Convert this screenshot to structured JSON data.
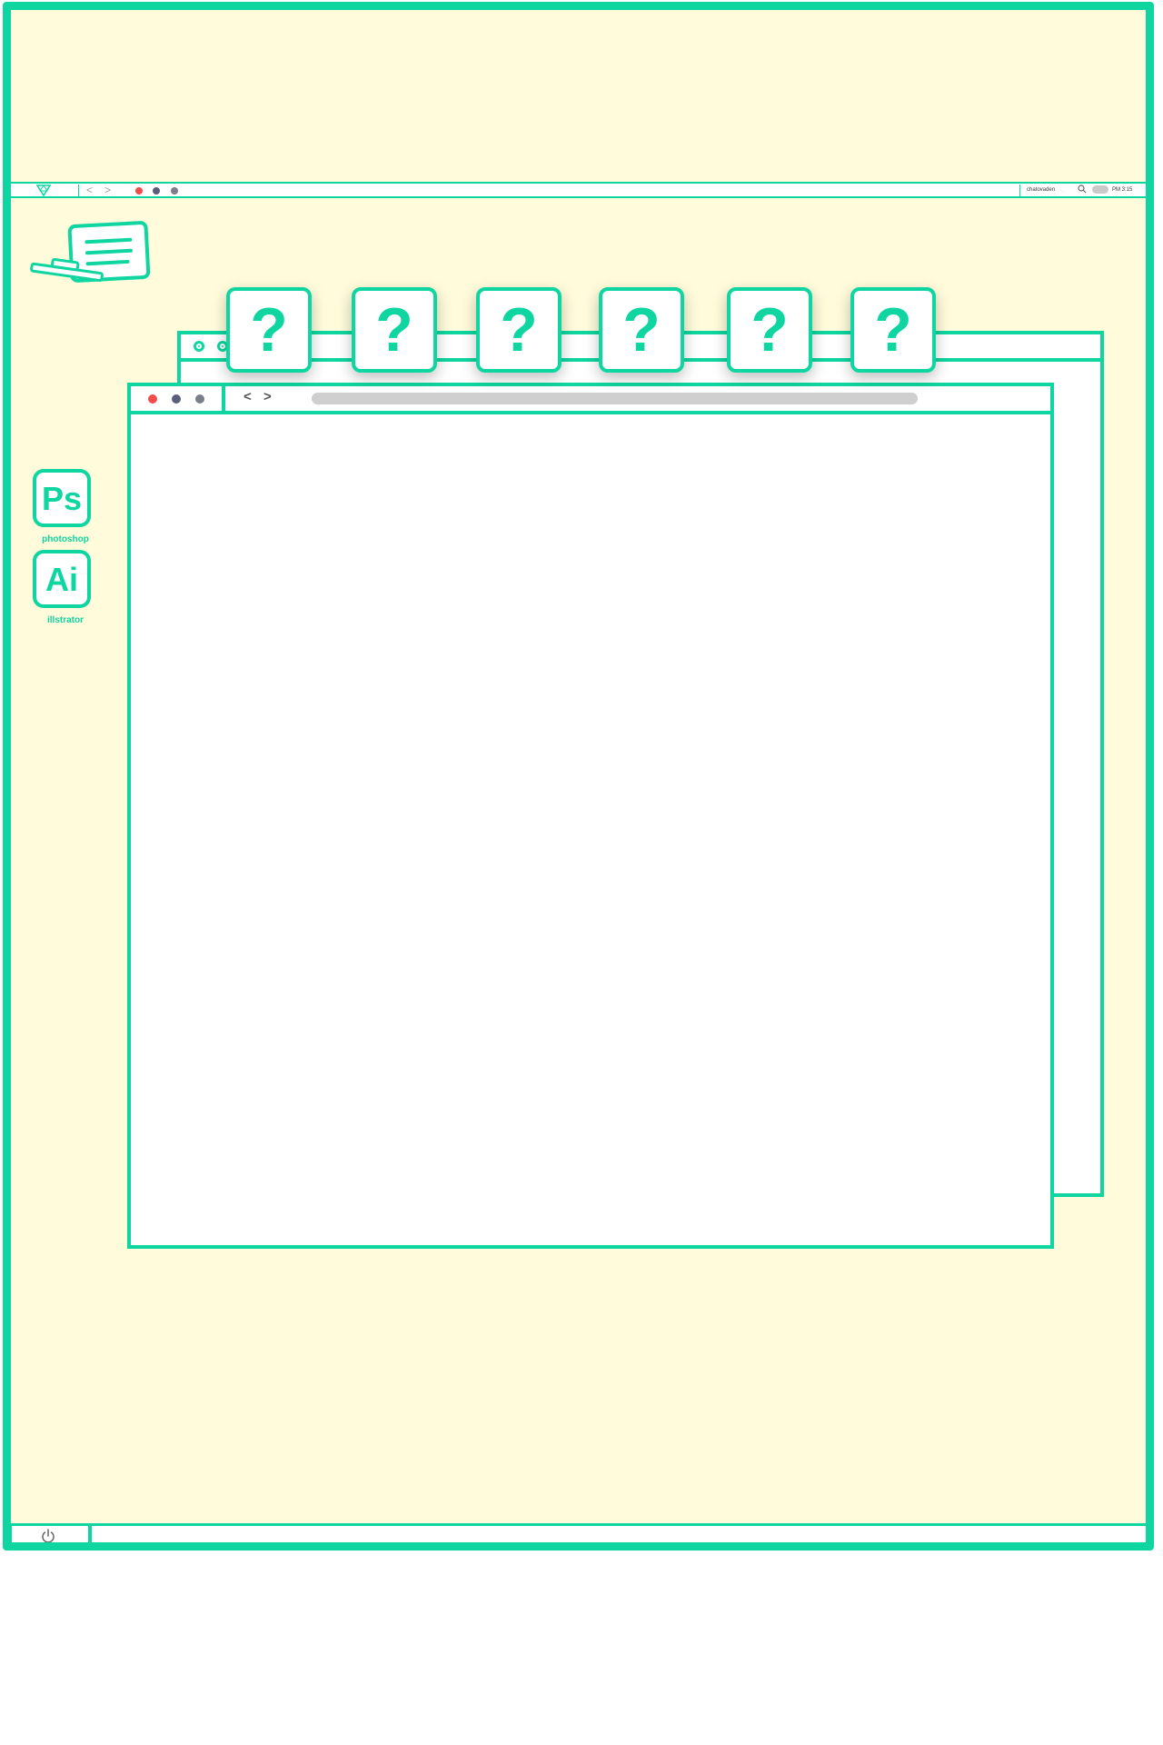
{
  "topbar": {
    "back_label": "<",
    "forward_label": ">",
    "user": "chatovaden",
    "time": "PM 3:15"
  },
  "desktop": {
    "icons": [
      {
        "label_text": "Ps",
        "caption": "photoshop"
      },
      {
        "label_text": "Ai",
        "caption": "illstrator"
      }
    ]
  },
  "windows": {
    "front": {
      "back_label": "<",
      "forward_label": ">"
    }
  },
  "dock": {
    "items": [
      {
        "label": "?"
      },
      {
        "label": "?"
      },
      {
        "label": "?"
      },
      {
        "label": "?"
      },
      {
        "label": "?"
      },
      {
        "label": "?"
      }
    ]
  },
  "colors": {
    "accent": "#0fd6a0",
    "background": "#fffbdb",
    "close_dot": "#f24b4b",
    "minimize_dot": "#5b5e7a",
    "zoom_dot": "#7b7e8a"
  }
}
